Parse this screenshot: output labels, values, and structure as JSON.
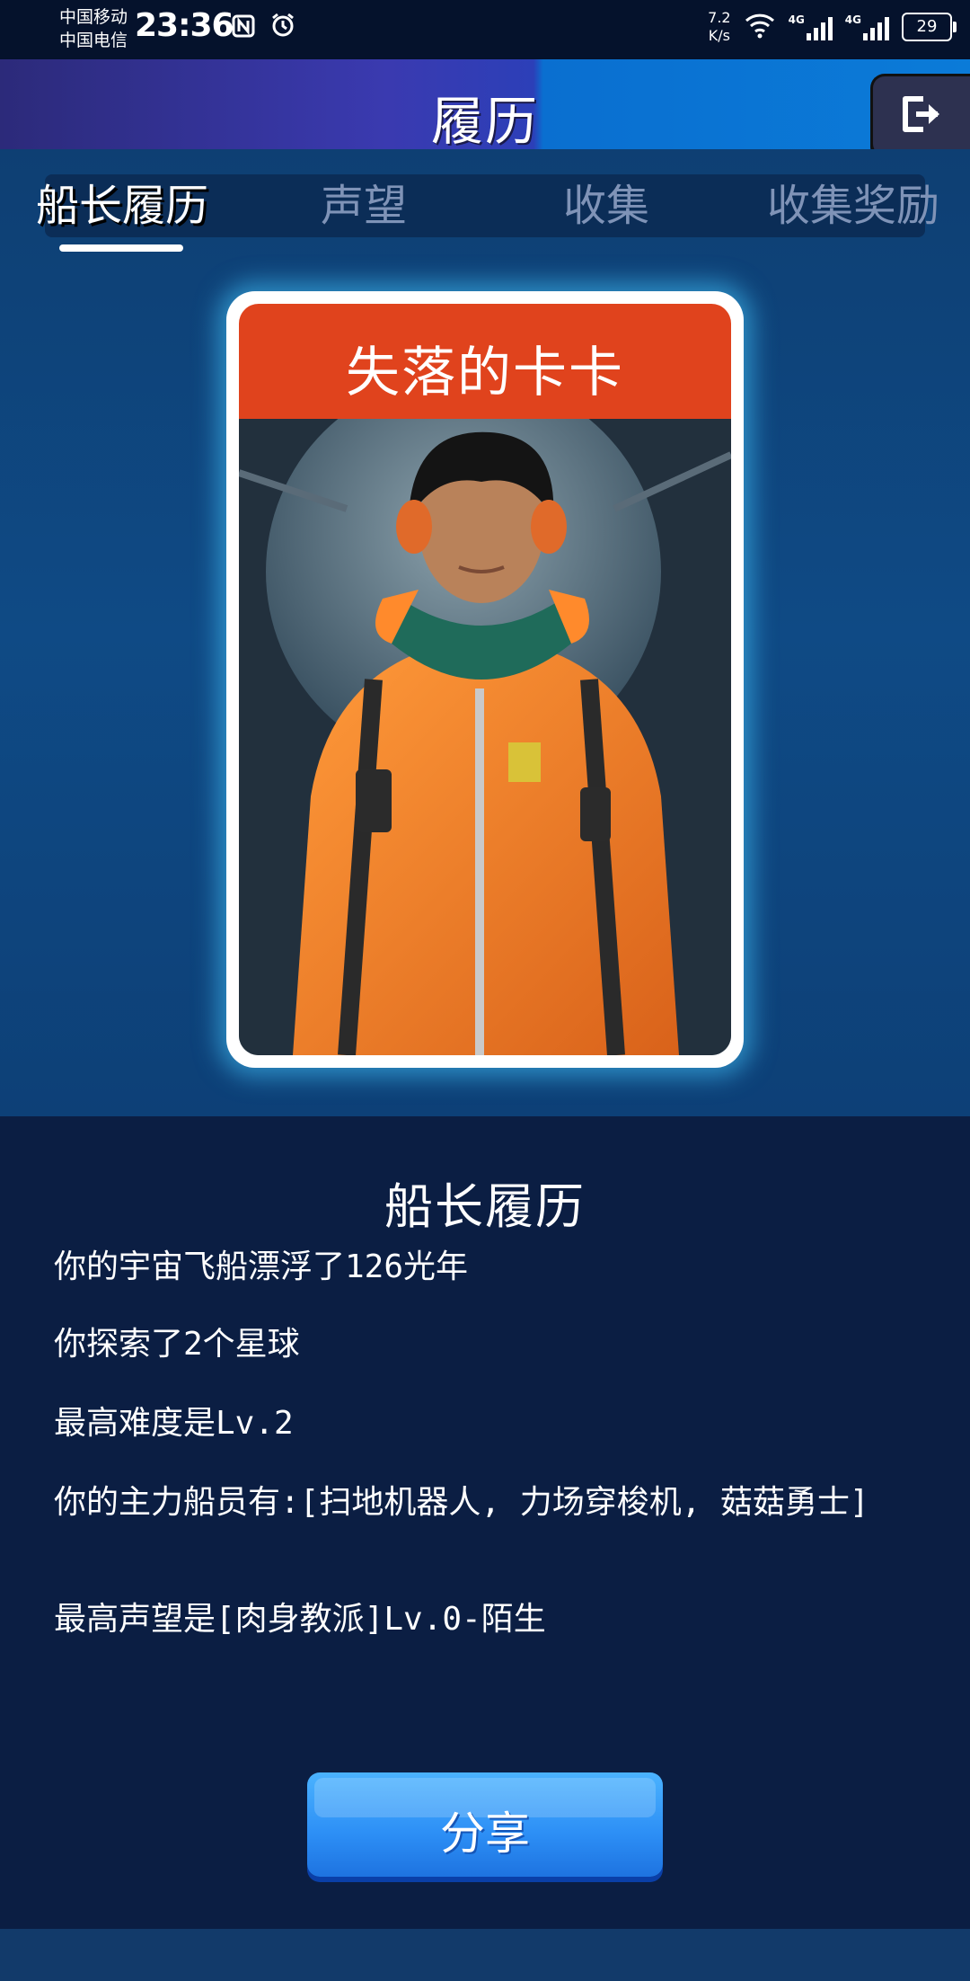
{
  "status_bar": {
    "carrier_1": "中国移动",
    "carrier_2": "中国电信",
    "time": "23:36",
    "net_speed_value": "7.2",
    "net_speed_unit": "K/s",
    "net_type_1": "4G",
    "net_type_2": "4G",
    "battery": "29",
    "icons": [
      "nfc-icon",
      "alarm-icon",
      "wifi-icon",
      "signal-icon",
      "battery-icon"
    ]
  },
  "header": {
    "title": "履历",
    "exit_icon": "exit-icon"
  },
  "tabs": [
    {
      "label": "船长履历",
      "active": true
    },
    {
      "label": "声望",
      "active": false
    },
    {
      "label": "收集",
      "active": false
    },
    {
      "label": "收集奖励",
      "active": false
    }
  ],
  "card": {
    "name": "失落的卡卡",
    "banner_color": "#e0431d"
  },
  "details": {
    "title": "船长履历",
    "stats": [
      "你的宇宙飞船漂浮了126光年",
      "你探索了2个星球",
      "最高难度是Lv.2",
      "你的主力船员有:[扫地机器人, 力场穿梭机, 菇菇勇士]",
      "最高声望是[肉身教派]Lv.0-陌生"
    ]
  },
  "share_button": {
    "label": "分享"
  },
  "colors": {
    "accent": "#2c8ef5",
    "panel": "#0b1e43",
    "glow": "#46c8ff"
  }
}
